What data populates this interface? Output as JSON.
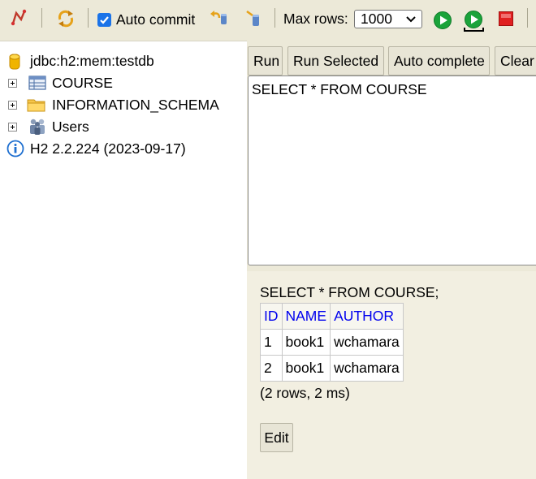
{
  "toolbar": {
    "auto_commit_label": "Auto commit",
    "auto_commit_checked": true,
    "max_rows_label": "Max rows:",
    "max_rows_value": "1000",
    "icons": [
      "disconnect-icon",
      "refresh-icon",
      "rollback-icon",
      "commit-icon",
      "run-icon",
      "run-selected-icon",
      "stop-icon"
    ]
  },
  "tree": {
    "connection": "jdbc:h2:mem:testdb",
    "items": [
      {
        "label": "COURSE",
        "icon": "table-icon"
      },
      {
        "label": "INFORMATION_SCHEMA",
        "icon": "folder-icon"
      },
      {
        "label": "Users",
        "icon": "users-icon"
      }
    ],
    "version": "H2 2.2.224 (2023-09-17)"
  },
  "query": {
    "buttons": {
      "run": "Run",
      "run_selected": "Run Selected",
      "auto_complete": "Auto complete",
      "clear": "Clear"
    },
    "sql": "SELECT * FROM COURSE"
  },
  "results": {
    "statement": "SELECT * FROM COURSE;",
    "columns": [
      "ID",
      "NAME",
      "AUTHOR"
    ],
    "rows": [
      [
        "1",
        "book1",
        "wchamara"
      ],
      [
        "2",
        "book1",
        "wchamara"
      ]
    ],
    "status": "(2 rows, 2 ms)",
    "edit_label": "Edit"
  },
  "colors": {
    "toolbar_bg": "#ece9d8",
    "results_bg": "#f2efe1",
    "header_link": "#0000ee",
    "run_green": "#1aa33a",
    "stop_red": "#e02020"
  }
}
